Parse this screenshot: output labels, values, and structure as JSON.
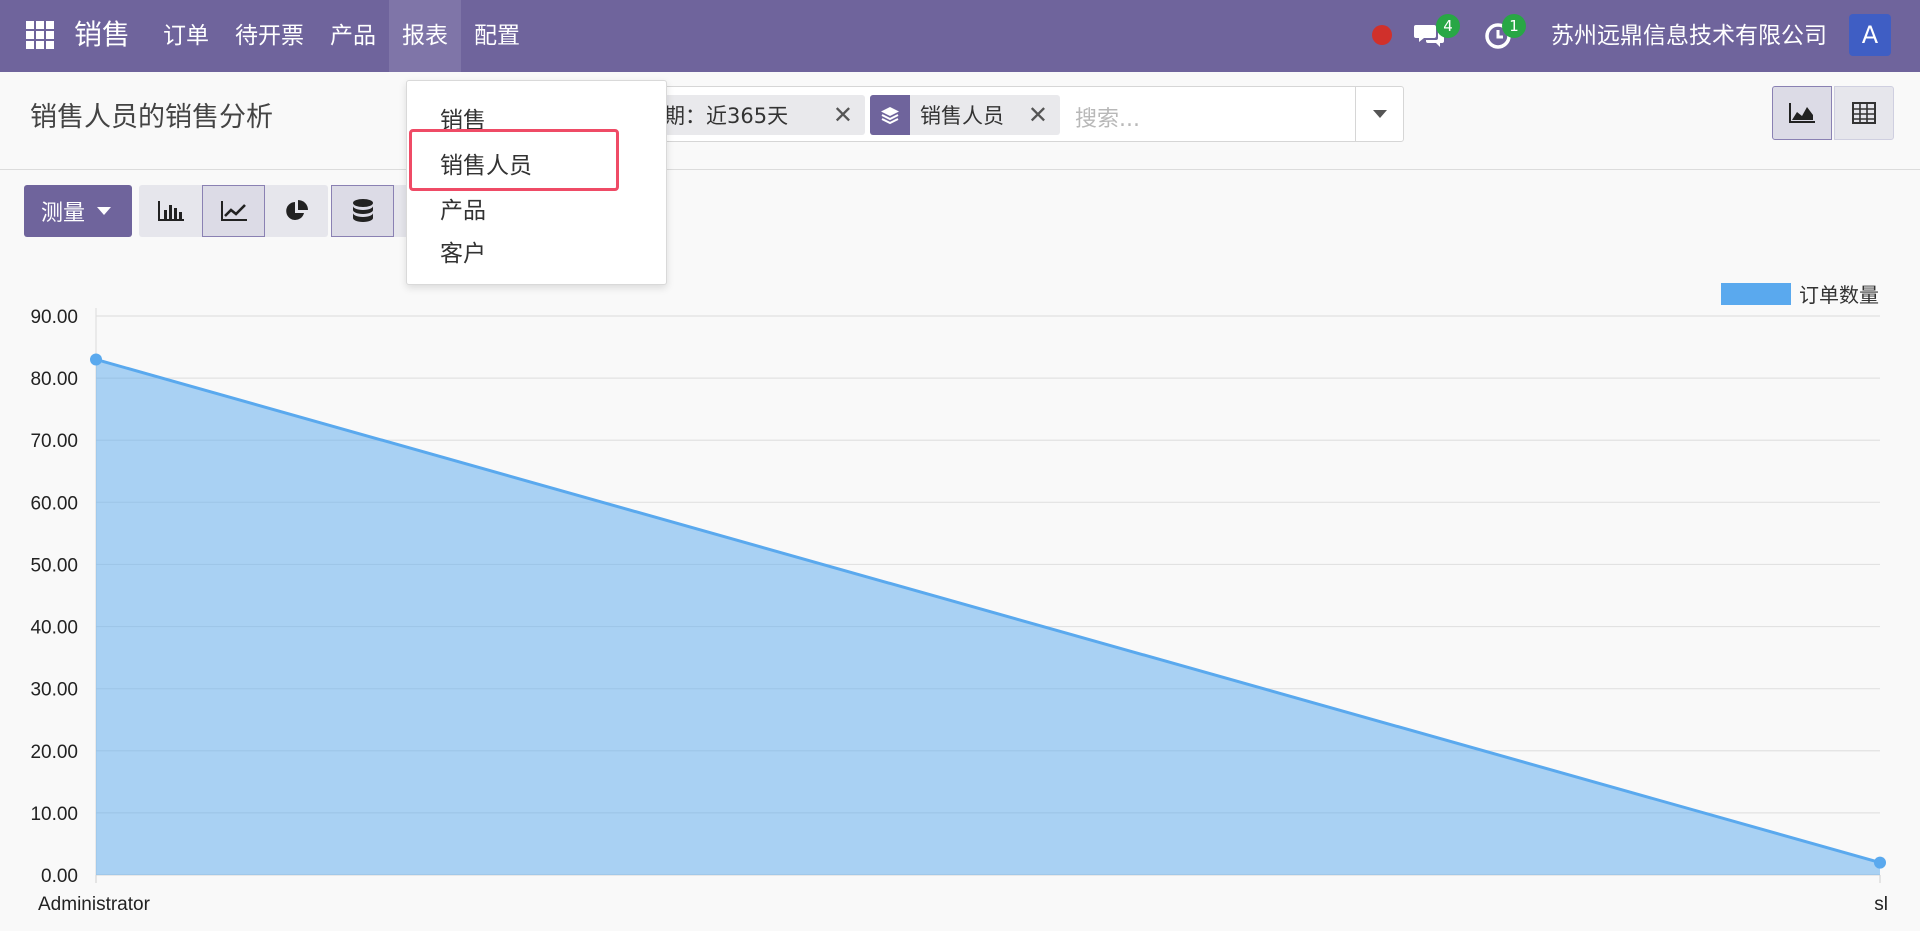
{
  "navbar": {
    "app_name": "销售",
    "menu": [
      "订单",
      "待开票",
      "产品",
      "报表",
      "配置"
    ],
    "active_menu_index": 3,
    "messages_count": "4",
    "activities_count": "1",
    "company": "苏州远鼎信息技术有限公司",
    "avatar_letter": "A",
    "accent_color": "#6f649c"
  },
  "control_panel": {
    "title": "销售人员的销售分析",
    "facets": {
      "date": "日期：近365天",
      "group": "销售人员"
    },
    "search_placeholder": "搜索..."
  },
  "toolbar": {
    "measure_label": "测量",
    "chart_types": [
      "bar-chart-icon",
      "line-chart-icon",
      "pie-chart-icon"
    ],
    "active_chart_type": "line"
  },
  "report_dropdown": {
    "items": [
      "销售",
      "销售人员",
      "产品",
      "客户"
    ],
    "highlighted_index": 1
  },
  "chart_data": {
    "type": "area",
    "categories": [
      "Administrator",
      "sl"
    ],
    "series": [
      {
        "name": "订单数量",
        "values": [
          83,
          2
        ],
        "color": "#5aa9ee"
      }
    ],
    "ylim": [
      0,
      90
    ],
    "yticks": [
      "0.00",
      "10.00",
      "20.00",
      "30.00",
      "40.00",
      "50.00",
      "60.00",
      "70.00",
      "80.00",
      "90.00"
    ],
    "grid": true,
    "legend_position": "top-right"
  }
}
